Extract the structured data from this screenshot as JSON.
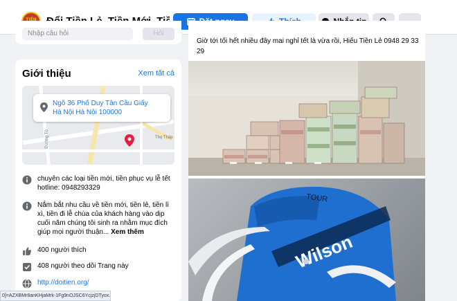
{
  "header": {
    "logo_text": "TIỀN MỚI TIỀN LẺ",
    "page_name": "Đổi Tiền Lẻ, Tiền Mới, Tiền Lì Xì...",
    "book_label": "Đặt ngay",
    "like_label": "Thích",
    "message_label": "Nhắn tin",
    "more_label": "···"
  },
  "ask": {
    "placeholder": "Nhập câu hỏi",
    "send_label": "Hỏi"
  },
  "about": {
    "title": "Giới thiệu",
    "see_all": "Xem tất cả",
    "map": {
      "address_line1": "Ngõ 36 Phố Duy Tân Cầu Giấy",
      "address_line2": "Hà Nội Hà Nội 100000",
      "street_label1": "Đường Tô",
      "street_label2": "Thọ Tháp",
      "street_label3": "Tr"
    },
    "description": "chuyên các loại tiền mới, tiền phục vụ lễ tết hotline: 0948293329",
    "detail": "Nắm bắt nhu cầu về tiền mới, tiền lẻ, tiền lì xì, tiền đi lễ chùa của khách hàng vào dịp cuối năm chúng tôi sinh ra nhằm mục đích giúp mọi người thuận...",
    "see_more": "Xem thêm",
    "likes": "400 người thích",
    "follows": "408 người theo dõi Trang này",
    "website": "http://doitien.org/"
  },
  "post": {
    "text": "Giờ tới tối hết nhiều đây mai nghỉ tết là vừa rồi, Hiếu Tiền Lẻ 0948 29 33 29",
    "bag_brand": "Wilson",
    "bag_label": "TOUR"
  },
  "statusbar": {
    "url": "0]=AZXBMr8anKHjaMrk-1Fg9nOJSC6YcjzjDTyox..."
  },
  "colors": {
    "primary": "#1b74e4",
    "link": "#1877f2",
    "like_bg": "#e7f3ff",
    "page_bg": "#f0f2f5"
  },
  "icons": [
    "calendar-icon",
    "thumbs-up-icon",
    "messenger-icon",
    "search-icon",
    "map-pin-icon",
    "info-icon",
    "like-count-icon",
    "follow-icon",
    "globe-icon"
  ]
}
